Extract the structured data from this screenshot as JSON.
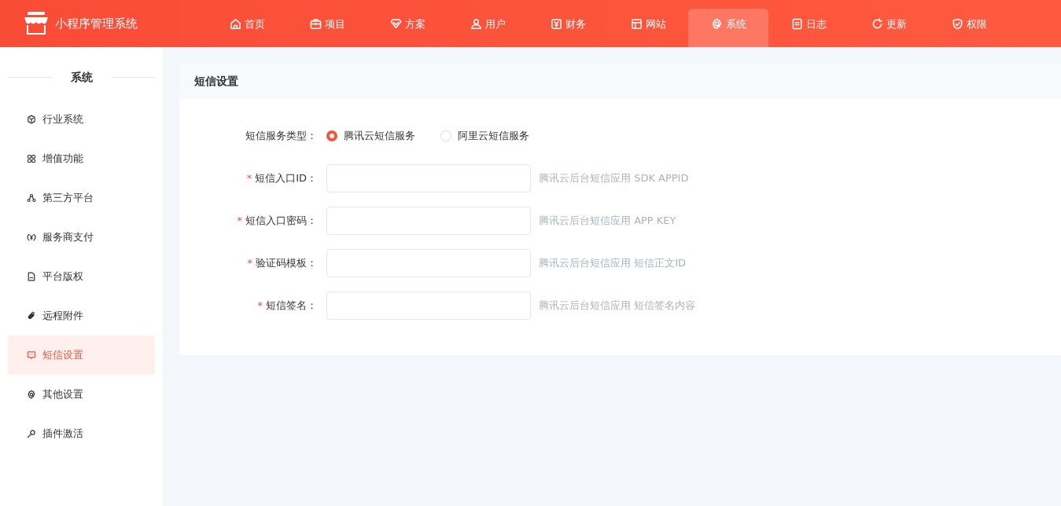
{
  "app": {
    "title": "小程序管理系统"
  },
  "nav": [
    {
      "label": "首页",
      "selected": false
    },
    {
      "label": "项目",
      "selected": false
    },
    {
      "label": "方案",
      "selected": false
    },
    {
      "label": "用户",
      "selected": false
    },
    {
      "label": "财务",
      "selected": false
    },
    {
      "label": "网站",
      "selected": false
    },
    {
      "label": "系统",
      "selected": true
    },
    {
      "label": "日志",
      "selected": false
    },
    {
      "label": "更新",
      "selected": false
    },
    {
      "label": "权限",
      "selected": false
    }
  ],
  "sidebar": {
    "title": "系统",
    "items": [
      {
        "label": "行业系统",
        "selected": false
      },
      {
        "label": "增值功能",
        "selected": false
      },
      {
        "label": "第三方平台",
        "selected": false
      },
      {
        "label": "服务商支付",
        "selected": false
      },
      {
        "label": "平台版权",
        "selected": false
      },
      {
        "label": "远程附件",
        "selected": false
      },
      {
        "label": "短信设置",
        "selected": true
      },
      {
        "label": "其他设置",
        "selected": false
      },
      {
        "label": "插件激活",
        "selected": false
      }
    ]
  },
  "panel": {
    "title": "短信设置",
    "service_type": {
      "label": "短信服务类型：",
      "options": [
        {
          "label": "腾讯云短信服务",
          "selected": true
        },
        {
          "label": "阿里云短信服务",
          "selected": false
        }
      ]
    },
    "fields": [
      {
        "label": "短信入口ID：",
        "required_mark": "*",
        "hint": "腾讯云后台短信应用 SDK APPID"
      },
      {
        "label": "短信入口密码：",
        "required_mark": "*",
        "hint": "腾讯云后台短信应用 APP KEY"
      },
      {
        "label": "验证码模板：",
        "required_mark": "*",
        "hint": "腾讯云后台短信应用 短信正文ID"
      },
      {
        "label": "短信签名：",
        "required_mark": "*",
        "hint": "腾讯云后台短信应用 短信签名内容"
      }
    ]
  }
}
